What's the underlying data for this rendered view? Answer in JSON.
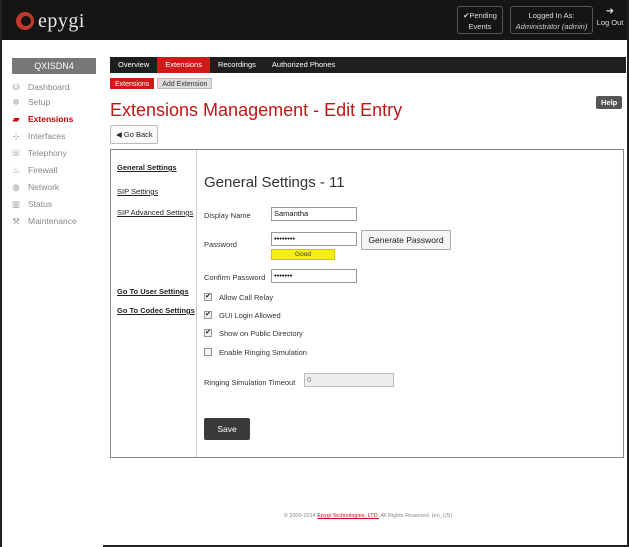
{
  "header": {
    "logo_text": "epygi",
    "pending_line1": "✔Pending",
    "pending_line2": "Events",
    "logged_line1": "Logged In As:",
    "logged_line2": "Administrator (admin)",
    "logout_label": "Log Out"
  },
  "sidebar": {
    "device": "QXISDN4",
    "items": [
      {
        "label": "Dashboard",
        "icon": "dashboard-icon",
        "glyph": "⛁"
      },
      {
        "label": "Setup",
        "icon": "gear-icon",
        "glyph": "✲"
      },
      {
        "label": "Extensions",
        "icon": "extensions-icon",
        "glyph": "▰"
      },
      {
        "label": "Interfaces",
        "icon": "interfaces-icon",
        "glyph": "⊹"
      },
      {
        "label": "Telephony",
        "icon": "phone-icon",
        "glyph": "☏"
      },
      {
        "label": "Firewall",
        "icon": "flame-icon",
        "glyph": "♨"
      },
      {
        "label": "Network",
        "icon": "globe-icon",
        "glyph": "◍"
      },
      {
        "label": "Status",
        "icon": "bar-chart-icon",
        "glyph": "▥"
      },
      {
        "label": "Maintenance",
        "icon": "wrench-icon",
        "glyph": "⚒"
      }
    ]
  },
  "tabs": [
    "Overview",
    "Extensions",
    "Recordings",
    "Authorized Phones"
  ],
  "subtabs": [
    "Extensions",
    "Add Extension"
  ],
  "page_title": "Extensions Management - Edit Entry",
  "help_label": "Help",
  "go_back_label": "Go Back",
  "left_links": {
    "general": "General Settings",
    "sip": "SIP Settings",
    "sip_adv": "SIP Advanced Settings",
    "user": "Go To User Settings",
    "codec": "Go To Codec Settings"
  },
  "form": {
    "title": "General Settings - 11",
    "display_name_label": "Display Name",
    "display_name_value": "Samantha",
    "password_label": "Password",
    "password_value": "••••••••",
    "generate_label": "Generate Password",
    "strength_label": "Good",
    "confirm_label": "Confirm Password",
    "confirm_value": "•••••••",
    "allow_relay": "Allow Call Relay",
    "gui_login": "GUI Login Allowed",
    "public_dir": "Show on Public Directory",
    "ringing_sim": "Enable Ringing Simulation",
    "ringing_timeout_label": "Ringing Simulation Timeout",
    "ringing_timeout_value": "0",
    "save_label": "Save"
  },
  "checkbox_states": {
    "allow_relay": true,
    "gui_login": true,
    "public_dir": true,
    "ringing_sim": false
  },
  "footer": {
    "prefix": "© 2000-2014",
    "link": "Epygi Technologies, LTD.",
    "suffix": "All Rights Reserved. (en_US)"
  },
  "colors": {
    "accent": "#d01a1a",
    "header_bg": "#151515",
    "strength": "#f5ee15"
  }
}
